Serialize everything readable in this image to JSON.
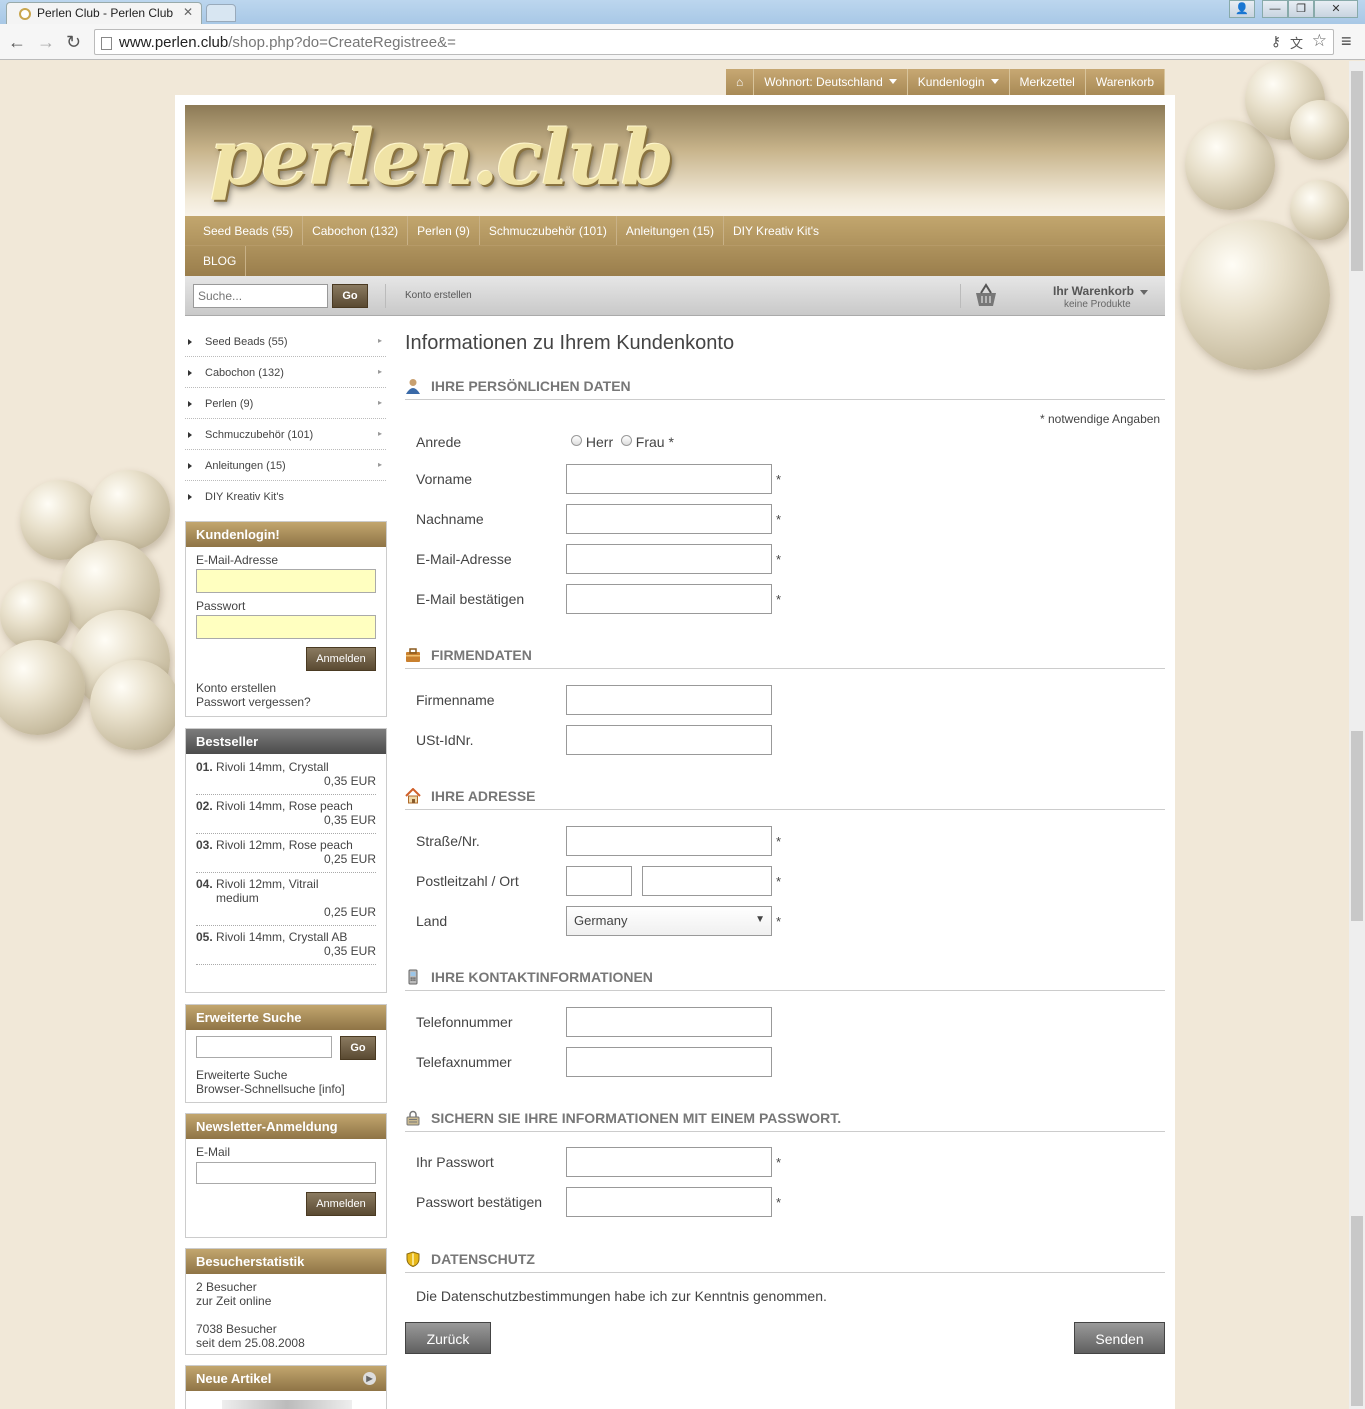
{
  "browser": {
    "tab_title": "Perlen Club - Perlen Club",
    "url_host": "www.perlen.club",
    "url_path": "/shop.php?do=CreateRegistree&="
  },
  "topnav": {
    "wohnort": "Wohnort: Deutschland",
    "kundenlogin": "Kundenlogin",
    "merkzettel": "Merkzettel",
    "warenkorb": "Warenkorb"
  },
  "logo_text": "perlen.club",
  "categories_row1": [
    "Seed Beads (55)",
    "Cabochon (132)",
    "Perlen (9)",
    "Schmuczubehör (101)",
    "Anleitungen (15)",
    "DIY Kreativ Kit's"
  ],
  "categories_row2": [
    "BLOG"
  ],
  "toolbar": {
    "search_placeholder": "Suche...",
    "go": "Go",
    "konto": "Konto erstellen",
    "cart_title": "Ihr Warenkorb",
    "cart_sub": "keine Produkte"
  },
  "sidebar_categories": [
    "Seed Beads (55)",
    "Cabochon (132)",
    "Perlen (9)",
    "Schmuczubehör (101)",
    "Anleitungen (15)",
    "DIY Kreativ Kit's"
  ],
  "login_box": {
    "title": "Kundenlogin!",
    "email_label": "E-Mail-Adresse",
    "password_label": "Passwort",
    "button": "Anmelden",
    "create": "Konto erstellen",
    "forgot": "Passwort vergessen?"
  },
  "bestseller": {
    "title": "Bestseller",
    "items": [
      {
        "num": "01.",
        "name": "Rivoli 14mm, Crystall",
        "price": "0,35 EUR"
      },
      {
        "num": "02.",
        "name": "Rivoli 14mm, Rose peach",
        "price": "0,35 EUR"
      },
      {
        "num": "03.",
        "name": "Rivoli 12mm, Rose peach",
        "price": "0,25 EUR"
      },
      {
        "num": "04.",
        "name": "Rivoli 12mm, Vitrail medium",
        "price": "0,25 EUR"
      },
      {
        "num": "05.",
        "name": "Rivoli 14mm, Crystall AB",
        "price": "0,35 EUR"
      }
    ]
  },
  "adv_search": {
    "title": "Erweiterte Suche",
    "go": "Go",
    "link1": "Erweiterte Suche",
    "link2": "Browser-Schnellsuche [info]"
  },
  "newsletter": {
    "title": "Newsletter-Anmeldung",
    "email_label": "E-Mail",
    "button": "Anmelden"
  },
  "stats": {
    "title": "Besucherstatistik",
    "line1": "2 Besucher",
    "line2": "zur Zeit online",
    "line3": "7038 Besucher",
    "line4": "seit dem 25.08.2008"
  },
  "neue_artikel": {
    "title": "Neue Artikel"
  },
  "form": {
    "title": "Informationen zu Ihrem Kundenkonto",
    "required_note": "* notwendige Angaben",
    "sec_personal": "IHRE PERSÖNLICHEN DATEN",
    "anrede": "Anrede",
    "herr": "Herr",
    "frau": "Frau *",
    "vorname": "Vorname",
    "nachname": "Nachname",
    "email": "E-Mail-Adresse",
    "email_confirm": "E-Mail bestätigen",
    "sec_company": "FIRMENDATEN",
    "firmenname": "Firmenname",
    "ust": "USt-IdNr.",
    "sec_address": "IHRE ADRESSE",
    "strasse": "Straße/Nr.",
    "plz": "Postleitzahl / Ort",
    "land": "Land",
    "land_value": "Germany",
    "sec_contact": "IHRE KONTAKTINFORMATIONEN",
    "telefon": "Telefonnummer",
    "telefax": "Telefaxnummer",
    "sec_password": "SICHERN SIE IHRE INFORMATIONEN MIT EINEM PASSWORT.",
    "passwort": "Ihr Passwort",
    "passwort_confirm": "Passwort bestätigen",
    "sec_privacy": "DATENSCHUTZ",
    "privacy_text": "Die Datenschutzbestimmungen habe ich zur Kenntnis genommen.",
    "back": "Zurück",
    "send": "Senden",
    "req": "*"
  }
}
